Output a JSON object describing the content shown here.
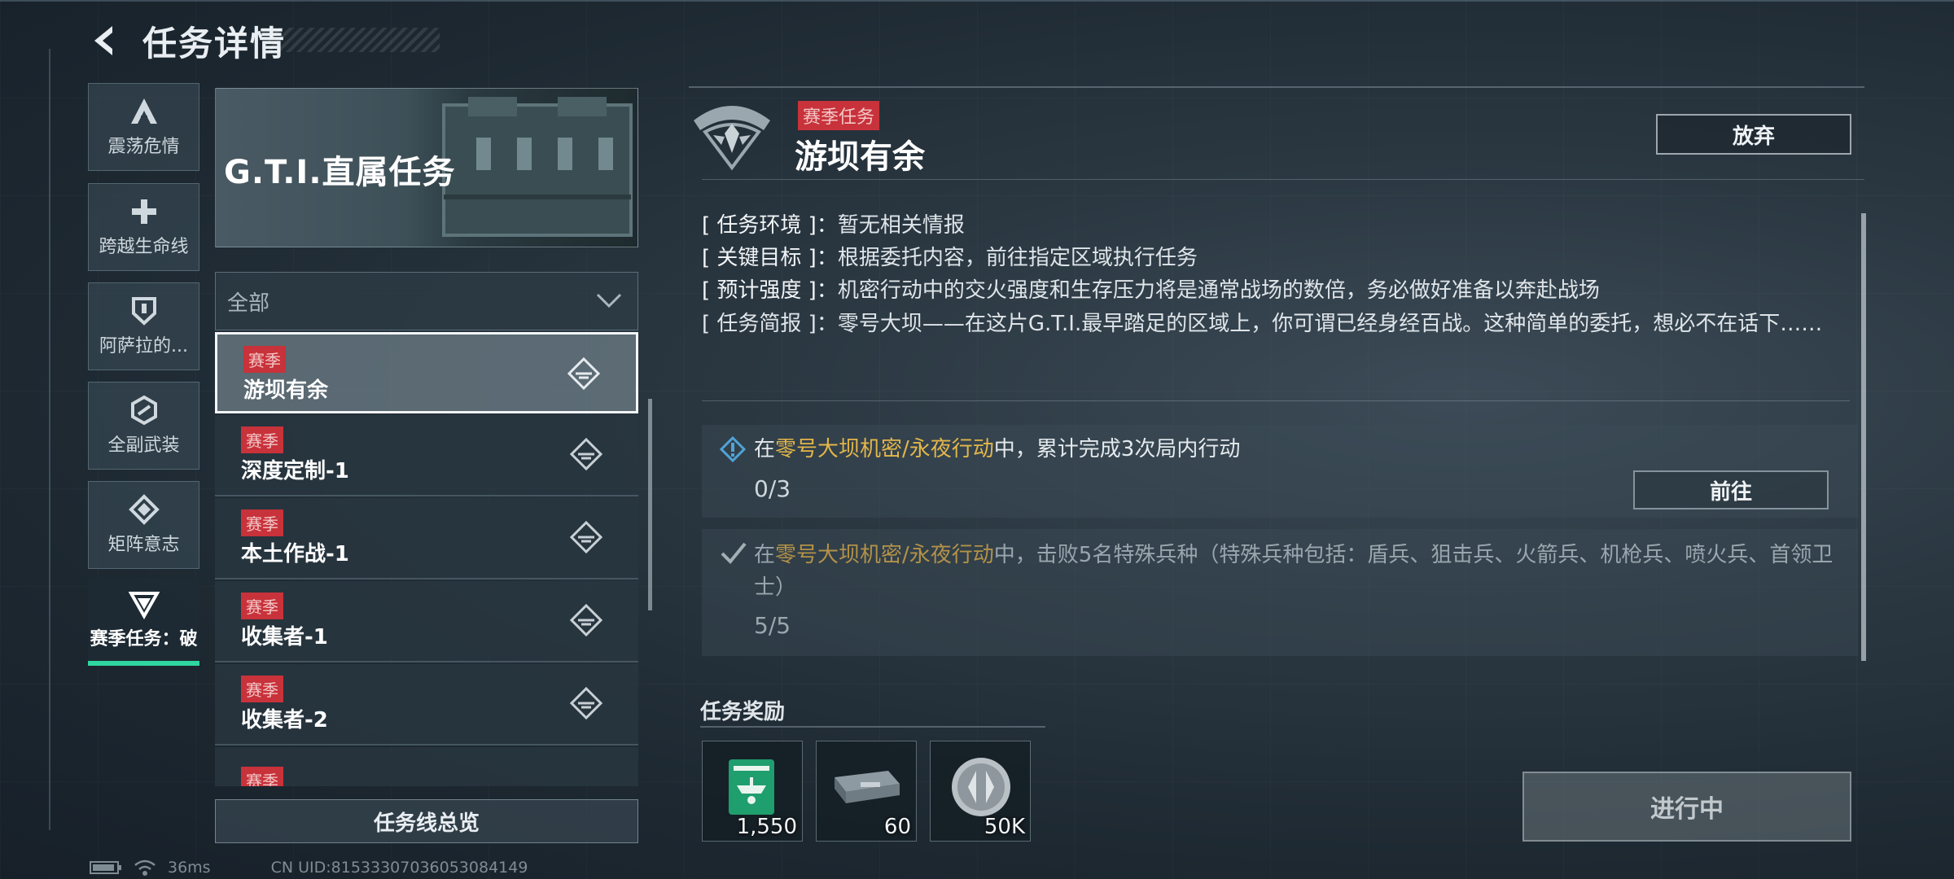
{
  "header": {
    "title": "任务详情"
  },
  "sidebar": {
    "categories": [
      {
        "label": "震荡危情",
        "icon": "delta-a-icon"
      },
      {
        "label": "跨越生命线",
        "icon": "plus-icon"
      },
      {
        "label": "阿萨拉的...",
        "icon": "shield-icon"
      },
      {
        "label": "全副武装",
        "icon": "hexagon-link-icon"
      },
      {
        "label": "矩阵意志",
        "icon": "diamond-cross-icon"
      },
      {
        "label": "赛季任务：破",
        "icon": "triangle-icon",
        "active": true
      }
    ]
  },
  "banner": {
    "title": "G.T.I.直属任务"
  },
  "filter": {
    "selected": "全部"
  },
  "quest_list": {
    "items": [
      {
        "tag": "赛季",
        "name": "游坝有余",
        "selected": true
      },
      {
        "tag": "赛季",
        "name": "深度定制-1"
      },
      {
        "tag": "赛季",
        "name": "本土作战-1"
      },
      {
        "tag": "赛季",
        "name": "收集者-1"
      },
      {
        "tag": "赛季",
        "name": "收集者-2"
      },
      {
        "tag": "赛季"
      }
    ],
    "overview_button": "任务线总览"
  },
  "status_bar": {
    "ping": "36ms",
    "uid": "CN UID:81533307036053084149"
  },
  "detail": {
    "tag": "赛季任务",
    "title": "游坝有余",
    "abandon_button": "放弃",
    "environment": {
      "key": "[ 任务环境 ]：",
      "value": "暂无相关情报"
    },
    "target": {
      "key": "[ 关键目标 ]：",
      "value": "根据委托内容，前往指定区域执行任务"
    },
    "intensity": {
      "key": "[ 预计强度 ]：",
      "value": "机密行动中的交火强度和生存压力将是通常战场的数倍，务必做好准备以奔赴战场"
    },
    "briefing": {
      "key": "[ 任务简报 ]：",
      "value": "零号大坝——在这片G.T.I.最早踏足的区域上，你可谓已经身经百战。这种简单的委托，想必不在话下……"
    },
    "objectives": [
      {
        "prefix": "在",
        "highlight": "零号大坝机密/永夜行动",
        "suffix": "中，累计完成3次局内行动",
        "progress": "0/3",
        "done": false
      },
      {
        "prefix": "在",
        "highlight": "零号大坝机密/永夜行动",
        "suffix": "中，击败5名特殊兵种（特殊兵种包括：盾兵、狙击兵、火箭兵、机枪兵、喷火兵、首领卫士）",
        "progress": "5/5",
        "done": true
      }
    ],
    "goto_button": "前往",
    "rewards_title": "任务奖励",
    "rewards": [
      {
        "icon": "helicopter-card-icon",
        "qty": "1,550"
      },
      {
        "icon": "ammo-box-icon",
        "qty": "60"
      },
      {
        "icon": "silver-coin-icon",
        "qty": "50K"
      }
    ],
    "status_button": "进行中"
  },
  "colors": {
    "accent": "#2fd7a0",
    "tag_red": "#c8323a",
    "highlight": "#e3b64a"
  }
}
